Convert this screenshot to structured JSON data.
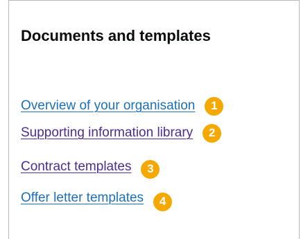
{
  "panel": {
    "heading": "Documents and templates",
    "links": [
      {
        "label": "Overview of your organisation",
        "marker": "1",
        "state": "unvisited"
      },
      {
        "label": "Supporting information library",
        "marker": "2",
        "state": "visited"
      },
      {
        "label": "Contract templates",
        "marker": "3",
        "state": "visited"
      },
      {
        "label": "Offer letter templates",
        "marker": "4",
        "state": "unvisited"
      }
    ]
  },
  "colors": {
    "link": "#1d70b8",
    "visited_link": "#4c2c92",
    "marker": "#f5a800",
    "heading": "#0b0c0c"
  }
}
